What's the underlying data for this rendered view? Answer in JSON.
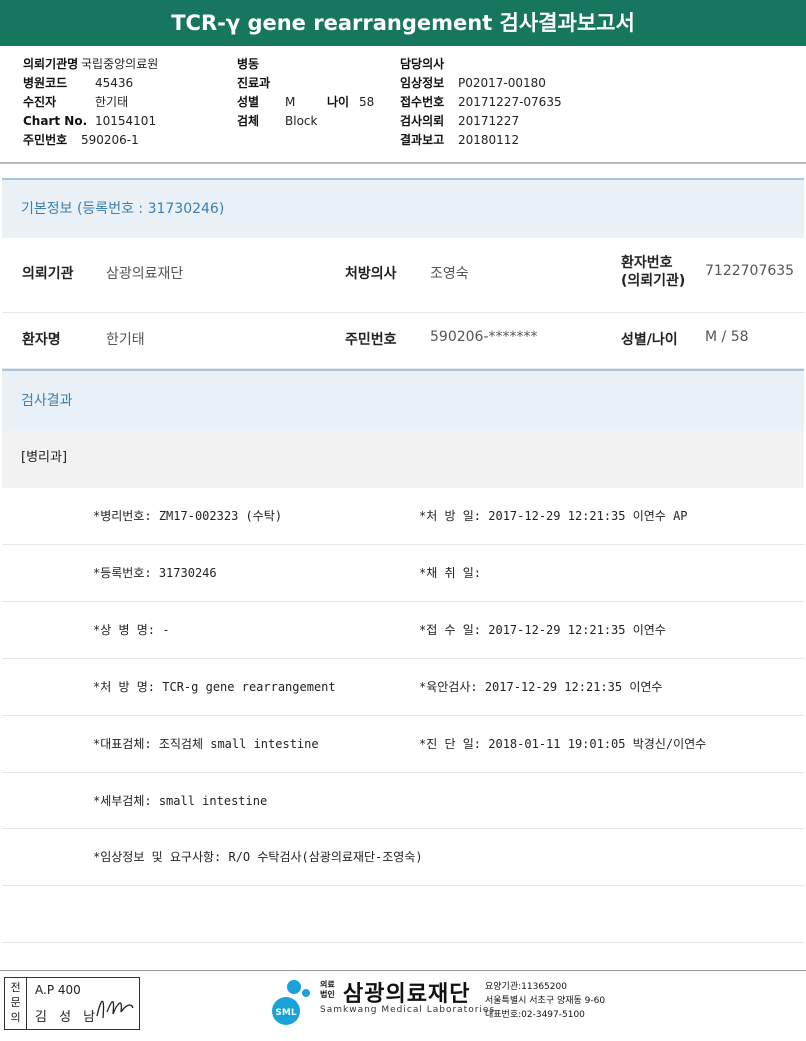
{
  "title": "TCR-γ gene rearrangement 검사결과보고서",
  "header": {
    "col1": [
      {
        "label": "의뢰기관명",
        "value": "국립중앙의료원"
      },
      {
        "label": "병원코드",
        "value": "45436"
      },
      {
        "label": "수진자",
        "value": "한기태"
      },
      {
        "label": "Chart No.",
        "value": "10154101"
      },
      {
        "label": "주민번호",
        "value": "590206-1"
      }
    ],
    "col2": [
      {
        "label": "병동",
        "value": ""
      },
      {
        "label": "진료과",
        "value": ""
      },
      {
        "label": "성별",
        "value": "M"
      },
      {
        "label": "검체",
        "value": "Block"
      }
    ],
    "age_label": "나이",
    "age_value": "58",
    "col3": [
      {
        "label": "담당의사",
        "value": ""
      },
      {
        "label": "임상정보",
        "value": "P02017-00180"
      },
      {
        "label": "접수번호",
        "value": "20171227-07635"
      },
      {
        "label": "검사의뢰",
        "value": "20171227"
      },
      {
        "label": "결과보고",
        "value": "20180112"
      }
    ]
  },
  "basic_info": {
    "section_title": "기본정보 (등록번호 : 31730246)",
    "rows": [
      {
        "k1": "의뢰기관",
        "v1": "삼광의료재단",
        "k2": "처방의사",
        "v2": "조영숙",
        "k3": "환자번호\n(의뢰기관)",
        "v3": "7122707635"
      },
      {
        "k1": "환자명",
        "v1": "한기태",
        "k2": "주민번호",
        "v2": "590206-*******",
        "k3": "성별/나이",
        "v3": "M / 58"
      }
    ]
  },
  "results": {
    "section_title": "검사결과",
    "category": "[병리과]",
    "rows": [
      {
        "left": "*병리번호: ZM17-002323 (수탁)",
        "right": "*처 방 일: 2017-12-29 12:21:35  이연수 AP"
      },
      {
        "left": "*등록번호: 31730246",
        "right": "*채 취 일:"
      },
      {
        "left": "*상 병 명: -",
        "right": "*접 수 일: 2017-12-29 12:21:35  이연수"
      },
      {
        "left": "*처 방 명: TCR-g gene rearrangement",
        "right": "*육안검사: 2017-12-29 12:21:35  이연수"
      },
      {
        "left": "*대표검체: 조직검체 small intestine",
        "right": "*진 단 일: 2018-01-11 19:01:05  박경신/이연수"
      },
      {
        "left": "*세부검체: small intestine",
        "right": ""
      },
      {
        "left": "*임상정보 및 요구사항: R/O 수탁검사(삼광의료재단-조영숙)",
        "right": ""
      },
      {
        "left": "",
        "right": ""
      }
    ]
  },
  "footer": {
    "specialist_vertical": "전\n문\n의",
    "ap_text": "A.P 400",
    "doctor_name": "김 성 남",
    "logo_text": "SML",
    "corp_label": "의료\n법인",
    "lab_name": "삼광의료재단",
    "lab_name_en": "Samkwang Medical Laboratories",
    "lab_code": "요양기관:11365200",
    "lab_address": "서울특별시 서초구 양재동 9-60",
    "lab_phone": "대표번호:02-3497-5100"
  },
  "colors": {
    "title_bg": "#17775e",
    "section_bg": "#e9f1f6",
    "section_text": "#3a7fb3",
    "logo_blue": "#1aa3d8"
  }
}
